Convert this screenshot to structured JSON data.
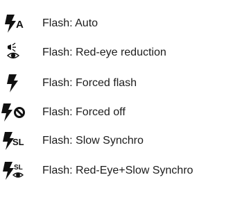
{
  "flash_modes": [
    {
      "icon": "flash-auto-icon",
      "icon_text": "A",
      "label": "Flash: Auto"
    },
    {
      "icon": "red-eye-reduction-icon",
      "label": "Flash: Red-eye reduction"
    },
    {
      "icon": "flash-forced-icon",
      "label": "Flash: Forced flash"
    },
    {
      "icon": "flash-off-icon",
      "label": "Flash: Forced off"
    },
    {
      "icon": "flash-slow-synchro-icon",
      "icon_text": "SL",
      "label": "Flash: Slow Synchro"
    },
    {
      "icon": "red-eye-slow-synchro-icon",
      "icon_text": "SL",
      "label": "Flash: Red-Eye+Slow Synchro"
    }
  ],
  "colors": {
    "text": "#1c1c1c",
    "icon": "#111111",
    "background": "#ffffff"
  }
}
